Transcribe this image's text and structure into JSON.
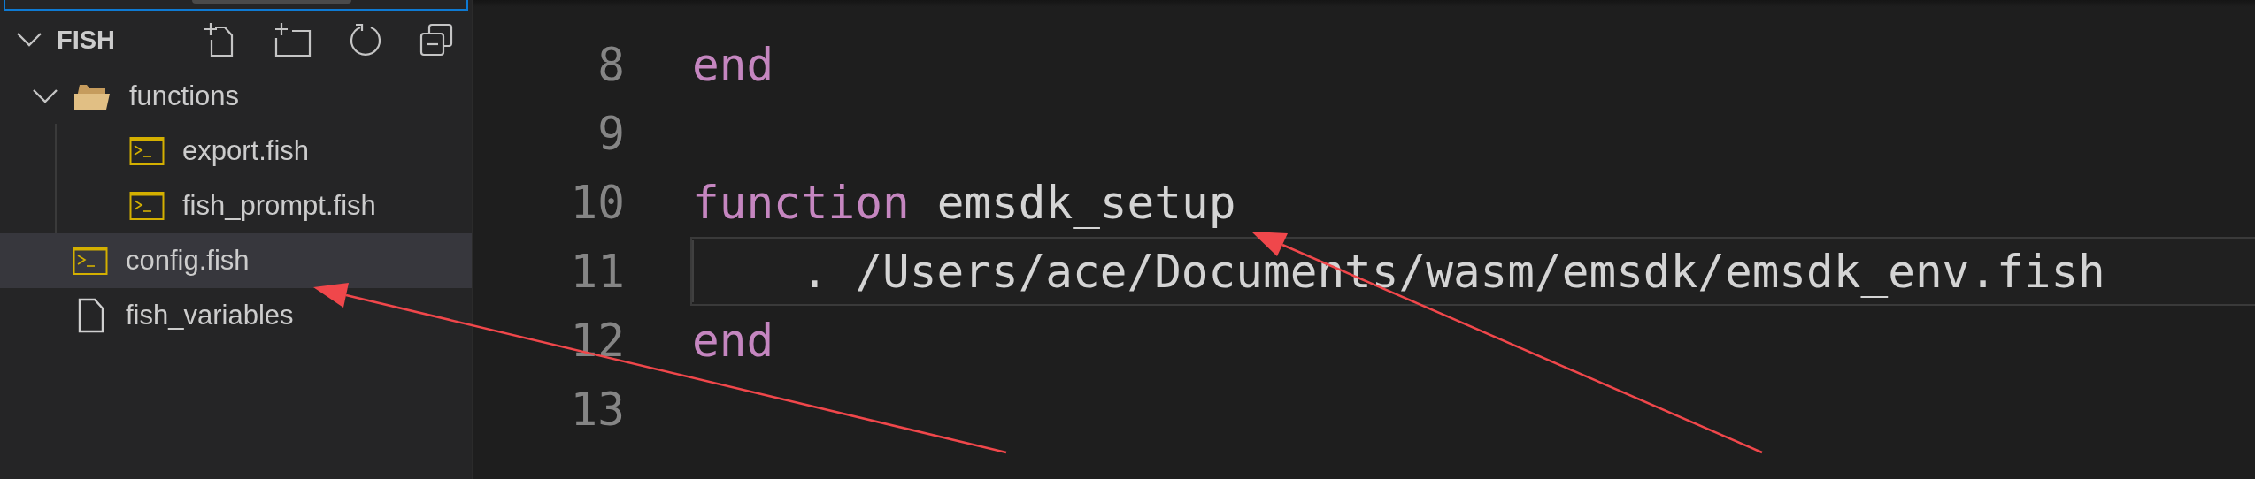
{
  "explorer": {
    "title": "FISH",
    "expanded": true,
    "tree": [
      {
        "name": "functions",
        "kind": "folder",
        "expanded": true,
        "selected": false,
        "children": [
          {
            "name": "export.fish",
            "kind": "fish",
            "selected": false
          },
          {
            "name": "fish_prompt.fish",
            "kind": "fish",
            "selected": false
          }
        ]
      },
      {
        "name": "config.fish",
        "kind": "fish",
        "selected": true
      },
      {
        "name": "fish_variables",
        "kind": "file",
        "selected": false
      }
    ]
  },
  "editor": {
    "lines": [
      {
        "number": "8",
        "current": false,
        "indented": false,
        "tokens": [
          {
            "text": "end",
            "kind": "keyword"
          }
        ]
      },
      {
        "number": "9",
        "current": false,
        "indented": false
      },
      {
        "number": "10",
        "current": false,
        "indented": false,
        "tokens": [
          {
            "text": "function",
            "kind": "keyword"
          },
          {
            "text": "emsdk_setup",
            "kind": "plain"
          }
        ]
      },
      {
        "number": "11",
        "current": true,
        "indented": true,
        "tokens": [
          {
            "text": ". /Users/ace/Documents/wasm/emsdk/emsdk_env.fish",
            "kind": "plain"
          }
        ]
      },
      {
        "number": "12",
        "current": false,
        "indented": false,
        "tokens": [
          {
            "text": "end",
            "kind": "keyword"
          }
        ]
      },
      {
        "number": "13",
        "current": false,
        "indented": false
      }
    ]
  }
}
